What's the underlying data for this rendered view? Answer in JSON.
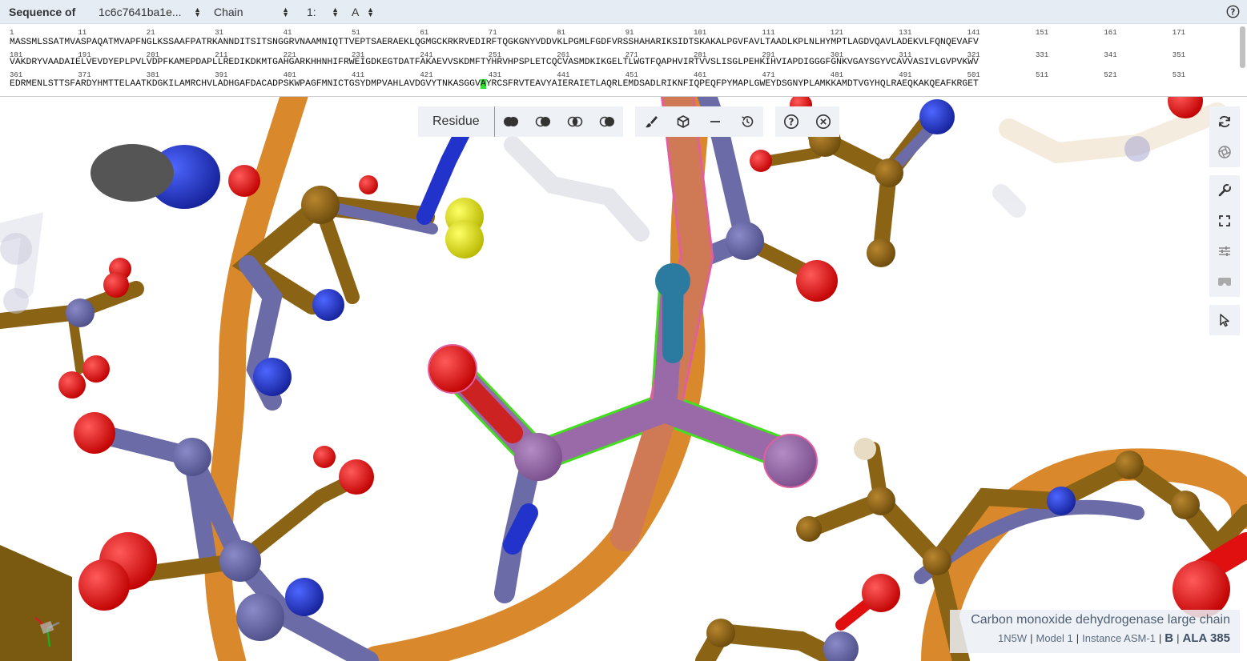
{
  "sequence_panel": {
    "title": "Sequence of",
    "entry": "1c6c7641ba1e...",
    "type": "Chain",
    "model": "1:",
    "chain": "A",
    "rows": [
      {
        "numbers": [
          "1",
          "11",
          "21",
          "31",
          "41",
          "51",
          "61",
          "71",
          "81",
          "91",
          "101",
          "111",
          "121",
          "131",
          "141",
          "151",
          "161",
          "171"
        ],
        "sequence": "MASSMLSSATMVASPAQATMVAPFNGLKSSAAFPATRKANNDITSITSNGGRVNAAMNIQTTVEPTSAERAEKLQGMGCKRKRVEDIRFTQGKGNYVDDVKLPGMLFGDFVRSSHAHARIKSIDTSKAKALPGVFAVLTAADLKPLNLHYMPTLAGDVQAVLADEKVLFQNQEVAFV"
      },
      {
        "numbers": [
          "181",
          "191",
          "201",
          "211",
          "221",
          "231",
          "241",
          "251",
          "261",
          "271",
          "281",
          "291",
          "301",
          "311",
          "321",
          "331",
          "341",
          "351"
        ],
        "sequence": "VAKDRYVAADAIELVEVDYEPLPVLVDPFKAMEPDAPLLREDIKDKMTGAHGARKHHNHIFRWEIGDKEGTDATFAKAEVVSKDMFTYHRVHPSPLETCQCVASMDKIKGELTLWGTFQAPHVIRTVVSLISGLPEHKIHVIAPDIGGGFGNKVGAYSGYVCAVVASIVLGVPVKWV"
      },
      {
        "numbers": [
          "361",
          "371",
          "381",
          "391",
          "401",
          "411",
          "421",
          "431",
          "441",
          "451",
          "461",
          "471",
          "481",
          "491",
          "501",
          "511",
          "521",
          "531"
        ],
        "sequence_before": "EDRMENLSTTSFARDYHMTTELAATKDGKILAMRCHVLADHGAFDACADPSKWPAGFMNICTGSYDMPVAHLAVDGVYTNKASGGV",
        "sequence_highlight": "A",
        "sequence_after": "YRCSFRVTEAVYAIERAIETLAQRLEMDSADLRIKNFIQPEQFPYMAPLGWEYDSGNYPLAMKKAMDTVGYHQLRAEQKAKQEAFKRGET"
      }
    ]
  },
  "toolbar": {
    "mode_label": "Residue",
    "buttons": [
      "select-union-icon",
      "select-subtract-icon",
      "select-intersect-icon",
      "select-set-icon",
      "brush-icon",
      "cube-icon",
      "minus-icon",
      "history-icon",
      "help-icon",
      "close-icon"
    ]
  },
  "rightbar": {
    "buttons": [
      "reset-view-icon",
      "screenshot-icon",
      "tools-icon",
      "fullscreen-icon",
      "settings-icon",
      "vr-icon",
      "select-mode-icon"
    ]
  },
  "info": {
    "name": "Carbon monoxide dehydrogenase large chain",
    "pdb": "1N5W",
    "model": "Model 1",
    "instance": "Instance ASM-1",
    "chain": "B",
    "residue": "ALA 385"
  },
  "colors": {
    "carbon_brown": "#8b6314",
    "carbon_slate": "#6b6ba8",
    "oxygen": "#e01010",
    "nitrogen": "#2233cc",
    "sulfur": "#dddd22",
    "cartoon_orange": "#d98a30",
    "selection_purple": "#9a6aa8",
    "highlight_green": "#44dd22"
  }
}
